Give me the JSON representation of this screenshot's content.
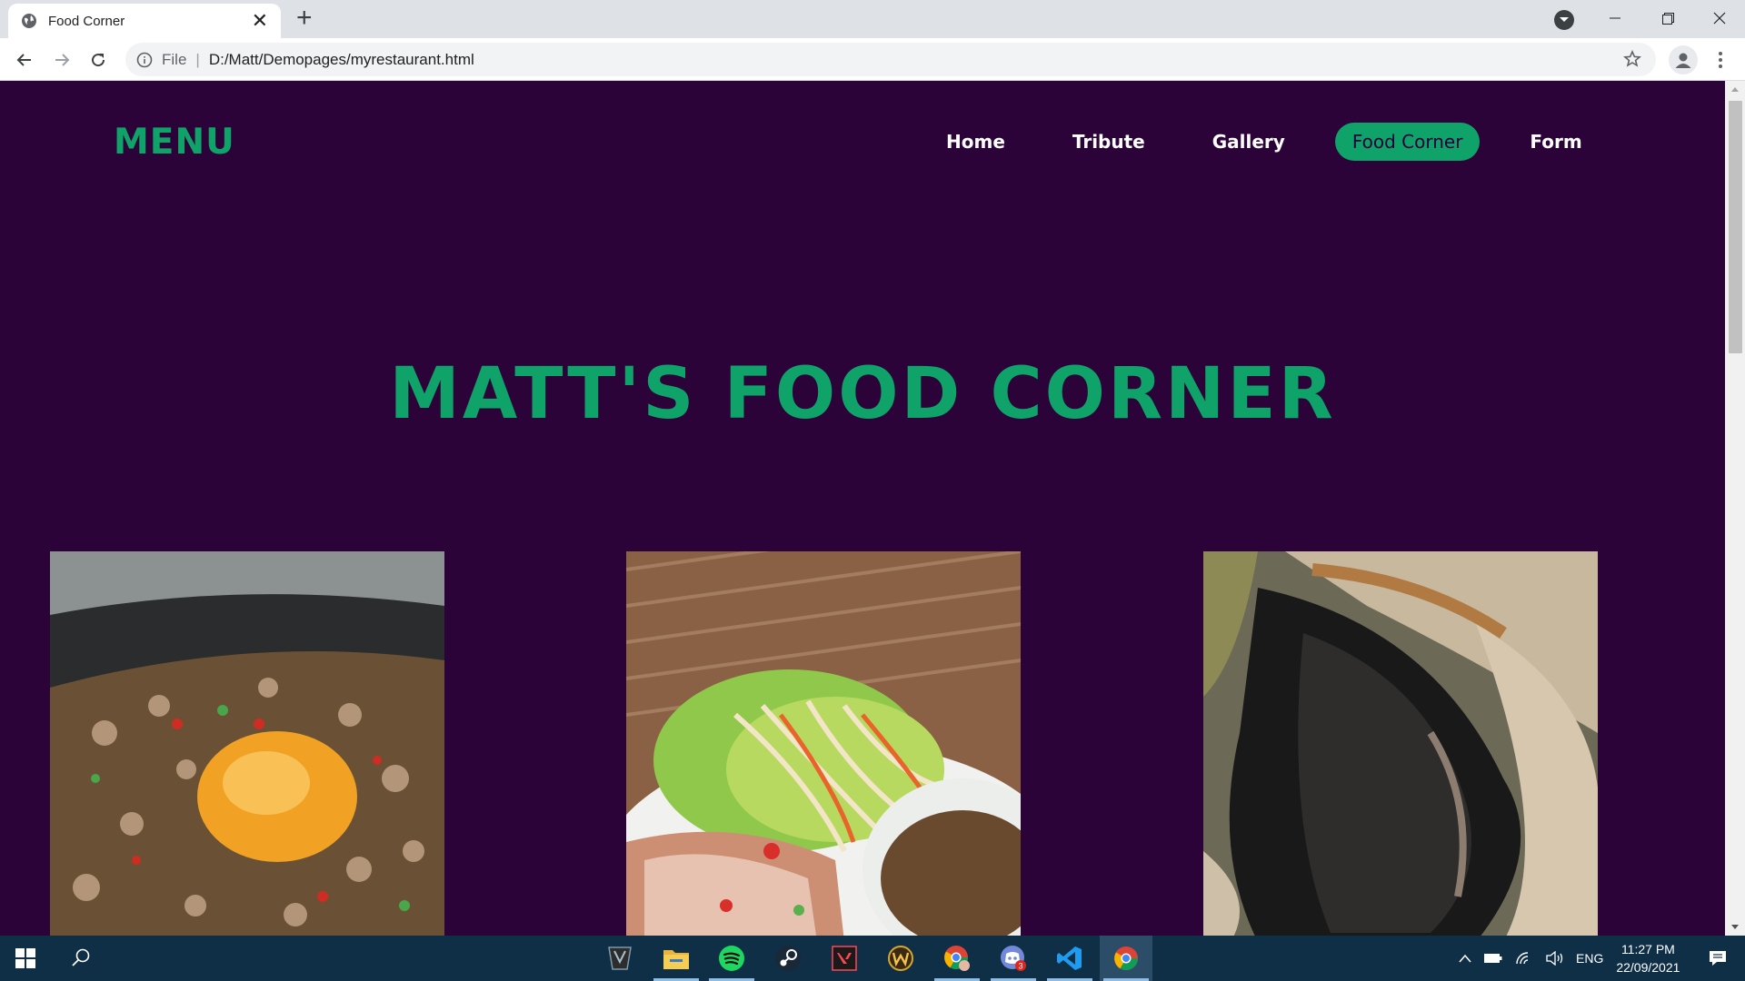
{
  "browser": {
    "tab_title": "Food Corner",
    "tab_close": "✕",
    "new_tab": "+",
    "address": {
      "scheme": "File",
      "separator": "|",
      "url": "D:/Matt/Demopages/myrestaurant.html"
    }
  },
  "site": {
    "logo": "MENU",
    "nav": [
      {
        "label": "Home",
        "active": false
      },
      {
        "label": "Tribute",
        "active": false
      },
      {
        "label": "Gallery",
        "active": false
      },
      {
        "label": "Food Corner",
        "active": true
      },
      {
        "label": "Form",
        "active": false
      }
    ],
    "hero_title": "MATT'S FOOD CORNER",
    "accent_color": "#0fa36a",
    "background_color": "#2b0339"
  },
  "taskbar": {
    "apps": [
      {
        "icon": "game-launcher-icon",
        "running": false,
        "active": false
      },
      {
        "icon": "file-explorer-icon",
        "running": true,
        "active": false
      },
      {
        "icon": "spotify-icon",
        "running": true,
        "active": false
      },
      {
        "icon": "steam-icon",
        "running": false,
        "active": false
      },
      {
        "icon": "valorant-icon",
        "running": false,
        "active": false
      },
      {
        "icon": "world-of-warcraft-icon",
        "running": false,
        "active": false
      },
      {
        "icon": "chrome-profile-icon",
        "running": true,
        "active": false
      },
      {
        "icon": "discord-icon",
        "running": true,
        "active": false,
        "badge": "3"
      },
      {
        "icon": "vscode-icon",
        "running": true,
        "active": false
      },
      {
        "icon": "chrome-icon",
        "running": true,
        "active": true
      }
    ],
    "tray": {
      "language": "ENG",
      "time": "11:27 PM",
      "date": "22/09/2021"
    }
  }
}
